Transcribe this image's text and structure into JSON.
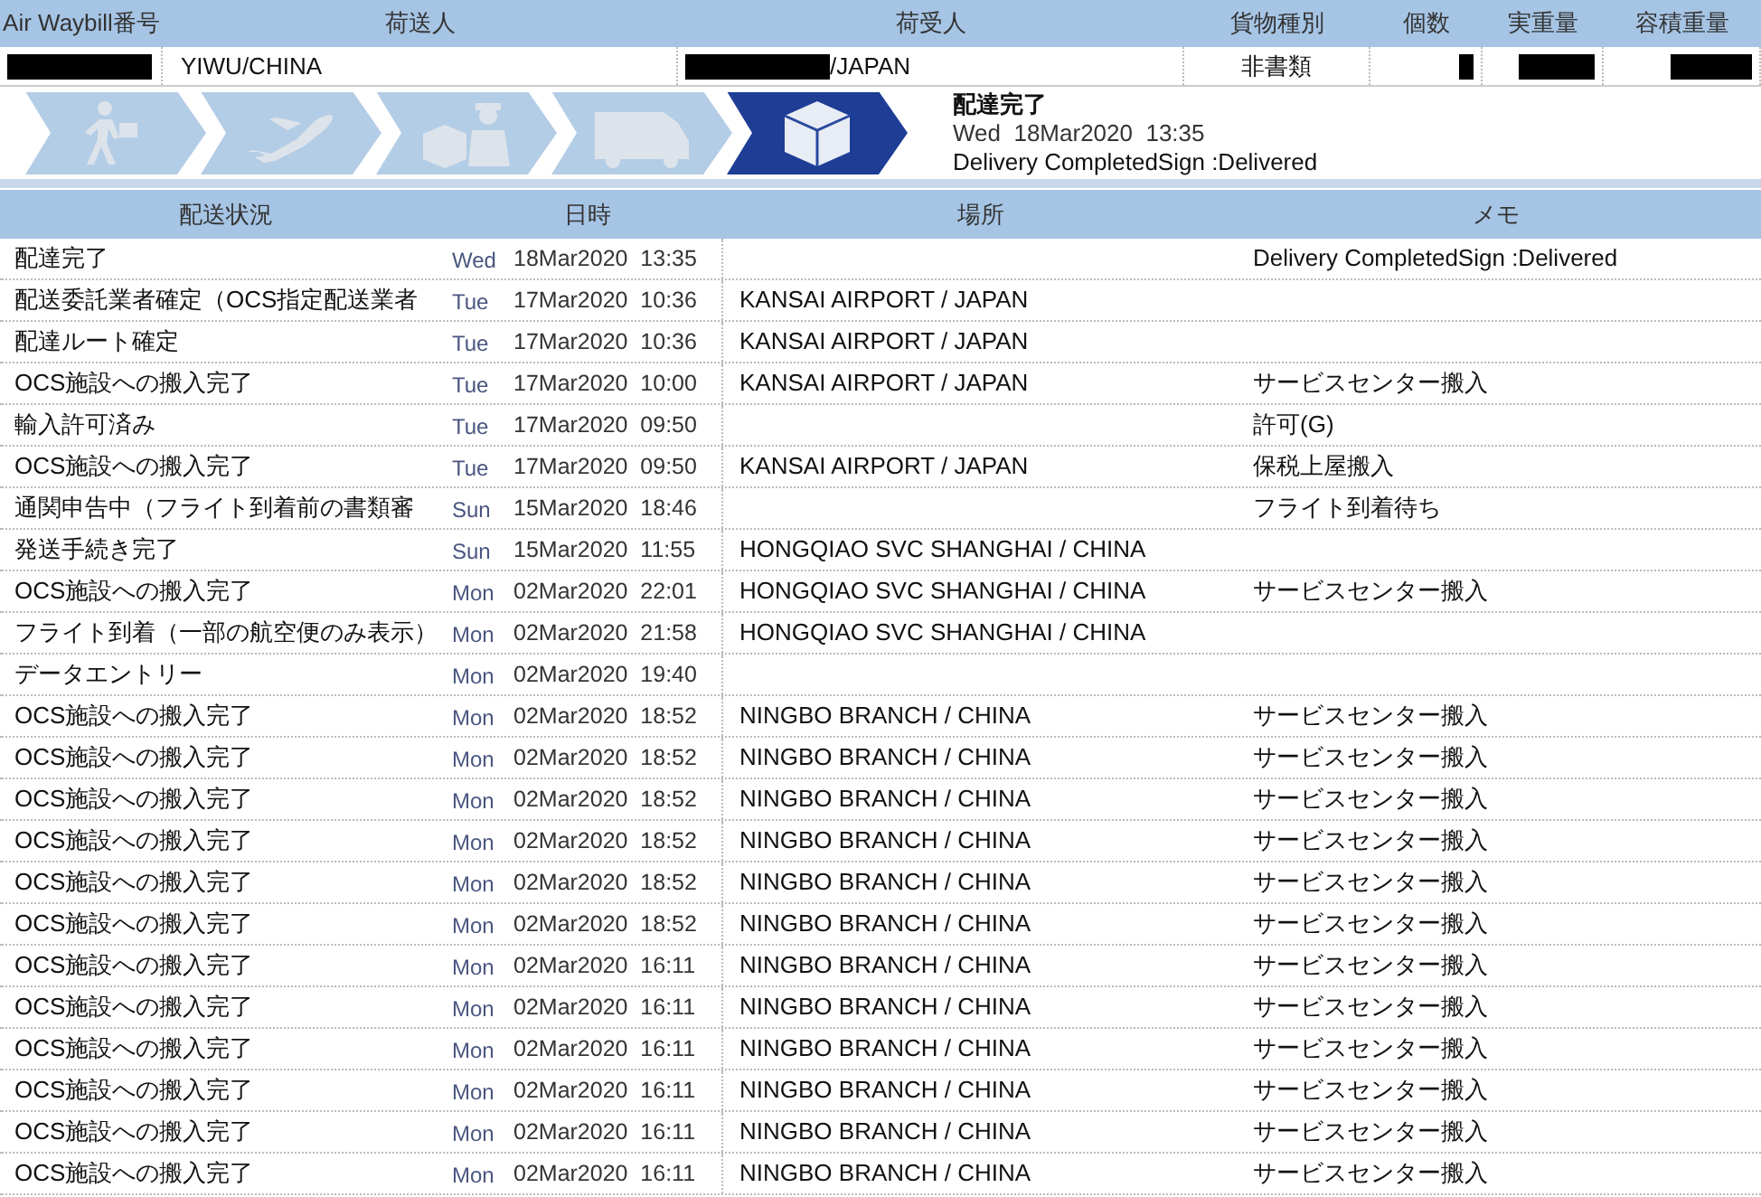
{
  "summary": {
    "columns": [
      "Air Waybill番号",
      "荷送人",
      "荷受人",
      "貨物種別",
      "個数",
      "実重量",
      "容積重量"
    ],
    "cells": [
      {
        "text": null,
        "redacted": true
      },
      {
        "text": "YIWU/CHINA",
        "redacted": false
      },
      {
        "text": "/JAPAN",
        "redacted": true
      },
      {
        "text": "非書類",
        "redacted": false
      },
      {
        "text": null,
        "redacted": true
      },
      {
        "text": null,
        "redacted": true
      },
      {
        "text": null,
        "redacted": true
      }
    ]
  },
  "progress": {
    "steps": [
      {
        "kind": "walker",
        "selected": false
      },
      {
        "kind": "plane",
        "selected": false
      },
      {
        "kind": "handover",
        "selected": false
      },
      {
        "kind": "truck",
        "selected": false
      },
      {
        "kind": "box",
        "selected": true
      }
    ],
    "status": "配達完了",
    "datetime": "Wed  18Mar2020  13:35",
    "note": "Delivery CompletedSign :Delivered"
  },
  "history": {
    "columns": [
      "配送状況",
      "日時",
      "場所",
      "メモ"
    ],
    "rows": [
      {
        "status": "配達完了",
        "day": "Wed",
        "date": "18Mar2020  13:35",
        "place": "",
        "memo": "Delivery CompletedSign :Delivered"
      },
      {
        "status": "配送委託業者確定（OCS指定配送業者",
        "day": "Tue",
        "date": "17Mar2020  10:36",
        "place": "KANSAI AIRPORT / JAPAN",
        "memo": ""
      },
      {
        "status": "配達ルート確定",
        "day": "Tue",
        "date": "17Mar2020  10:36",
        "place": "KANSAI AIRPORT / JAPAN",
        "memo": ""
      },
      {
        "status": "OCS施設への搬入完了",
        "day": "Tue",
        "date": "17Mar2020  10:00",
        "place": "KANSAI AIRPORT / JAPAN",
        "memo": "サービスセンター搬入"
      },
      {
        "status": "輸入許可済み",
        "day": "Tue",
        "date": "17Mar2020  09:50",
        "place": "",
        "memo": "許可(G)"
      },
      {
        "status": "OCS施設への搬入完了",
        "day": "Tue",
        "date": "17Mar2020  09:50",
        "place": "KANSAI AIRPORT / JAPAN",
        "memo": "保税上屋搬入"
      },
      {
        "status": "通関申告中（フライト到着前の書類審",
        "day": "Sun",
        "date": "15Mar2020  18:46",
        "place": "",
        "memo": "フライト到着待ち"
      },
      {
        "status": "発送手続き完了",
        "day": "Sun",
        "date": "15Mar2020  11:55",
        "place": "HONGQIAO SVC SHANGHAI / CHINA",
        "memo": ""
      },
      {
        "status": "OCS施設への搬入完了",
        "day": "Mon",
        "date": "02Mar2020  22:01",
        "place": "HONGQIAO SVC SHANGHAI / CHINA",
        "memo": "サービスセンター搬入"
      },
      {
        "status": "フライト到着（一部の航空便のみ表示）",
        "day": "Mon",
        "date": "02Mar2020  21:58",
        "place": "HONGQIAO SVC SHANGHAI / CHINA",
        "memo": ""
      },
      {
        "status": "データエントリー",
        "day": "Mon",
        "date": "02Mar2020  19:40",
        "place": "",
        "memo": ""
      },
      {
        "status": "OCS施設への搬入完了",
        "day": "Mon",
        "date": "02Mar2020  18:52",
        "place": "NINGBO BRANCH / CHINA",
        "memo": "サービスセンター搬入"
      },
      {
        "status": "OCS施設への搬入完了",
        "day": "Mon",
        "date": "02Mar2020  18:52",
        "place": "NINGBO BRANCH / CHINA",
        "memo": "サービスセンター搬入"
      },
      {
        "status": "OCS施設への搬入完了",
        "day": "Mon",
        "date": "02Mar2020  18:52",
        "place": "NINGBO BRANCH / CHINA",
        "memo": "サービスセンター搬入"
      },
      {
        "status": "OCS施設への搬入完了",
        "day": "Mon",
        "date": "02Mar2020  18:52",
        "place": "NINGBO BRANCH / CHINA",
        "memo": "サービスセンター搬入"
      },
      {
        "status": "OCS施設への搬入完了",
        "day": "Mon",
        "date": "02Mar2020  18:52",
        "place": "NINGBO BRANCH / CHINA",
        "memo": "サービスセンター搬入"
      },
      {
        "status": "OCS施設への搬入完了",
        "day": "Mon",
        "date": "02Mar2020  18:52",
        "place": "NINGBO BRANCH / CHINA",
        "memo": "サービスセンター搬入"
      },
      {
        "status": "OCS施設への搬入完了",
        "day": "Mon",
        "date": "02Mar2020  16:11",
        "place": "NINGBO BRANCH / CHINA",
        "memo": "サービスセンター搬入"
      },
      {
        "status": "OCS施設への搬入完了",
        "day": "Mon",
        "date": "02Mar2020  16:11",
        "place": "NINGBO BRANCH / CHINA",
        "memo": "サービスセンター搬入"
      },
      {
        "status": "OCS施設への搬入完了",
        "day": "Mon",
        "date": "02Mar2020  16:11",
        "place": "NINGBO BRANCH / CHINA",
        "memo": "サービスセンター搬入"
      },
      {
        "status": "OCS施設への搬入完了",
        "day": "Mon",
        "date": "02Mar2020  16:11",
        "place": "NINGBO BRANCH / CHINA",
        "memo": "サービスセンター搬入"
      },
      {
        "status": "OCS施設への搬入完了",
        "day": "Mon",
        "date": "02Mar2020  16:11",
        "place": "NINGBO BRANCH / CHINA",
        "memo": "サービスセンター搬入"
      },
      {
        "status": "OCS施設への搬入完了",
        "day": "Mon",
        "date": "02Mar2020  16:11",
        "place": "NINGBO BRANCH / CHINA",
        "memo": "サービスセンター搬入"
      }
    ]
  }
}
